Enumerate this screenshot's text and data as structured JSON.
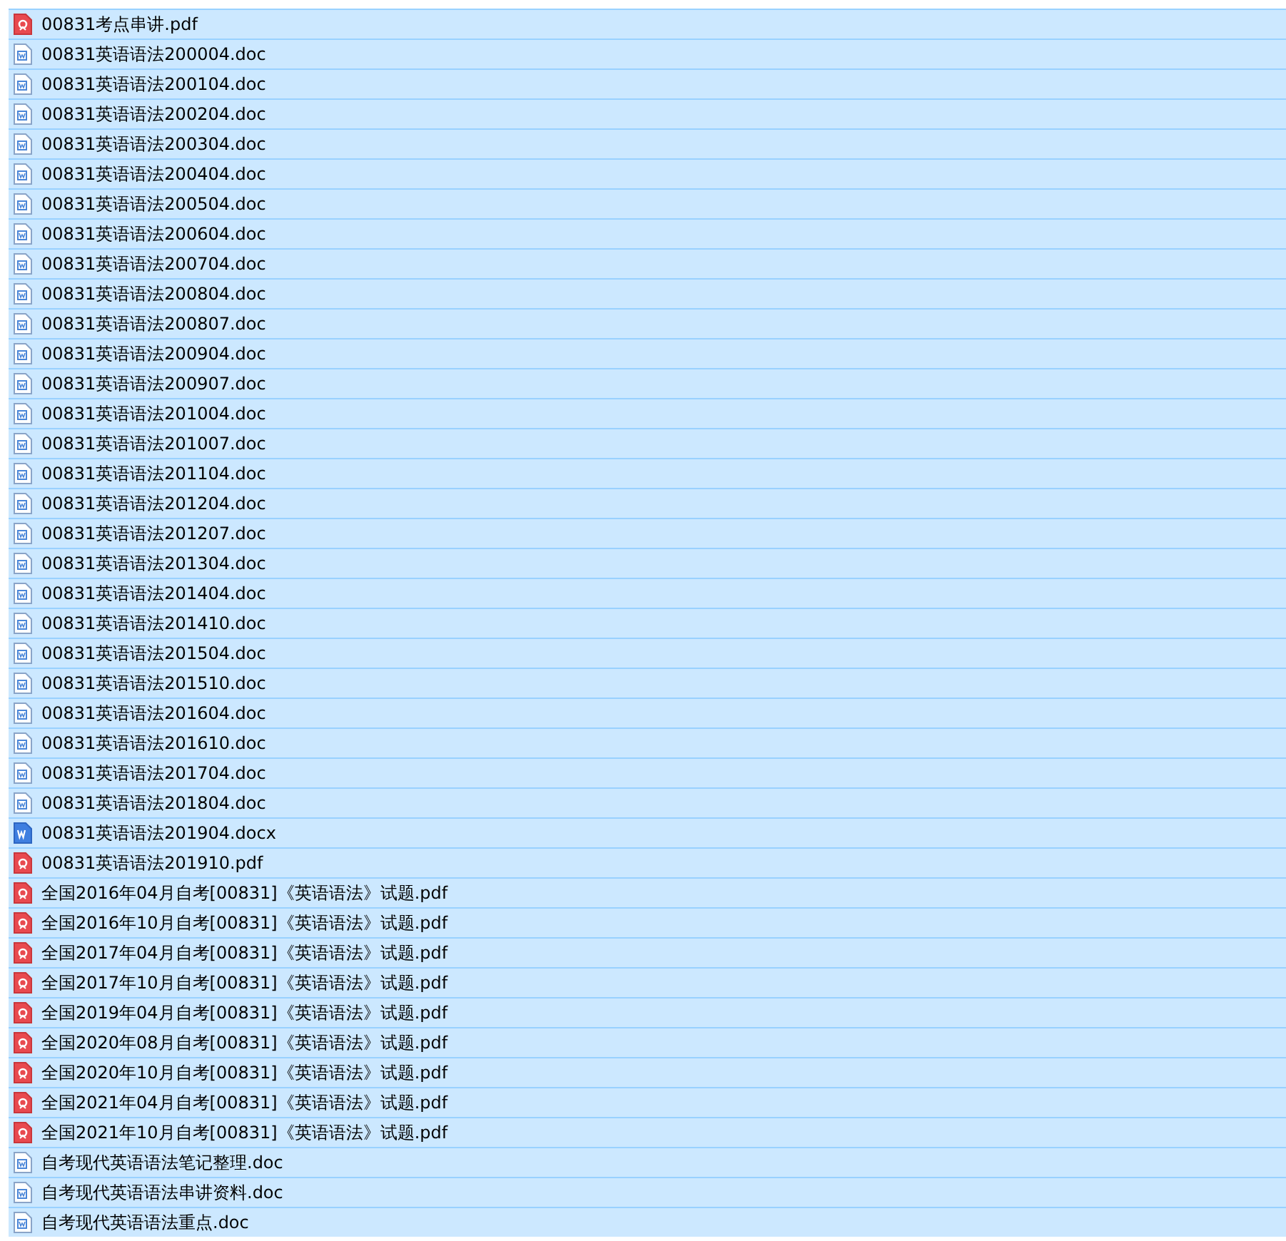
{
  "files": [
    {
      "name": "00831考点串讲.pdf",
      "kind": "pdf",
      "selected": true
    },
    {
      "name": "00831英语语法200004.doc",
      "kind": "doc",
      "selected": true
    },
    {
      "name": "00831英语语法200104.doc",
      "kind": "doc",
      "selected": true
    },
    {
      "name": "00831英语语法200204.doc",
      "kind": "doc",
      "selected": true
    },
    {
      "name": "00831英语语法200304.doc",
      "kind": "doc",
      "selected": true
    },
    {
      "name": "00831英语语法200404.doc",
      "kind": "doc",
      "selected": true
    },
    {
      "name": "00831英语语法200504.doc",
      "kind": "doc",
      "selected": true
    },
    {
      "name": "00831英语语法200604.doc",
      "kind": "doc",
      "selected": true
    },
    {
      "name": "00831英语语法200704.doc",
      "kind": "doc",
      "selected": true
    },
    {
      "name": "00831英语语法200804.doc",
      "kind": "doc",
      "selected": true
    },
    {
      "name": "00831英语语法200807.doc",
      "kind": "doc",
      "selected": true
    },
    {
      "name": "00831英语语法200904.doc",
      "kind": "doc",
      "selected": true
    },
    {
      "name": "00831英语语法200907.doc",
      "kind": "doc",
      "selected": true
    },
    {
      "name": "00831英语语法201004.doc",
      "kind": "doc",
      "selected": true
    },
    {
      "name": "00831英语语法201007.doc",
      "kind": "doc",
      "selected": true
    },
    {
      "name": "00831英语语法201104.doc",
      "kind": "doc",
      "selected": true
    },
    {
      "name": "00831英语语法201204.doc",
      "kind": "doc",
      "selected": true
    },
    {
      "name": "00831英语语法201207.doc",
      "kind": "doc",
      "selected": true
    },
    {
      "name": "00831英语语法201304.doc",
      "kind": "doc",
      "selected": true
    },
    {
      "name": "00831英语语法201404.doc",
      "kind": "doc",
      "selected": true
    },
    {
      "name": "00831英语语法201410.doc",
      "kind": "doc",
      "selected": true
    },
    {
      "name": "00831英语语法201504.doc",
      "kind": "doc",
      "selected": true
    },
    {
      "name": "00831英语语法201510.doc",
      "kind": "doc",
      "selected": true
    },
    {
      "name": "00831英语语法201604.doc",
      "kind": "doc",
      "selected": true
    },
    {
      "name": "00831英语语法201610.doc",
      "kind": "doc",
      "selected": true
    },
    {
      "name": "00831英语语法201704.doc",
      "kind": "doc",
      "selected": true
    },
    {
      "name": "00831英语语法201804.doc",
      "kind": "doc",
      "selected": true
    },
    {
      "name": "00831英语语法201904.docx",
      "kind": "docx",
      "selected": true
    },
    {
      "name": "00831英语语法201910.pdf",
      "kind": "pdf",
      "selected": true
    },
    {
      "name": "全国2016年04月自考[00831]《英语语法》试题.pdf",
      "kind": "pdf",
      "selected": true
    },
    {
      "name": "全国2016年10月自考[00831]《英语语法》试题.pdf",
      "kind": "pdf",
      "selected": true
    },
    {
      "name": "全国2017年04月自考[00831]《英语语法》试题.pdf",
      "kind": "pdf",
      "selected": true
    },
    {
      "name": "全国2017年10月自考[00831]《英语语法》试题.pdf",
      "kind": "pdf",
      "selected": true
    },
    {
      "name": "全国2019年04月自考[00831]《英语语法》试题.pdf",
      "kind": "pdf",
      "selected": true
    },
    {
      "name": "全国2020年08月自考[00831]《英语语法》试题.pdf",
      "kind": "pdf",
      "selected": true
    },
    {
      "name": "全国2020年10月自考[00831]《英语语法》试题.pdf",
      "kind": "pdf",
      "selected": true
    },
    {
      "name": "全国2021年04月自考[00831]《英语语法》试题.pdf",
      "kind": "pdf",
      "selected": true
    },
    {
      "name": "全国2021年10月自考[00831]《英语语法》试题.pdf",
      "kind": "pdf",
      "selected": true
    },
    {
      "name": "自考现代英语语法笔记整理.doc",
      "kind": "doc",
      "selected": true
    },
    {
      "name": "自考现代英语语法串讲资料.doc",
      "kind": "doc",
      "selected": true
    },
    {
      "name": "自考现代英语语法重点.doc",
      "kind": "doc",
      "selected": true
    }
  ]
}
